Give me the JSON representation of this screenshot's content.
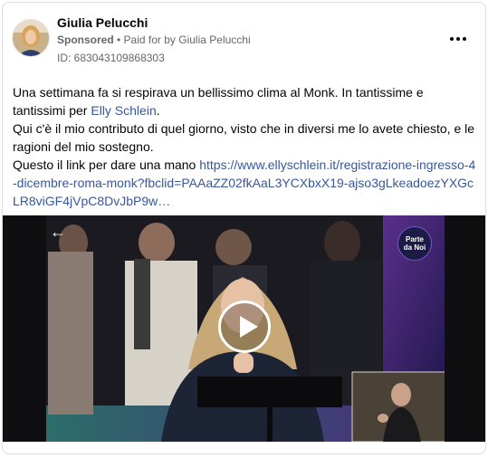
{
  "post": {
    "author": "Giulia Pelucchi",
    "sponsored": "Sponsored",
    "paid_prefix": " • Paid for by ",
    "paid_by": "Giulia Pelucchi",
    "id_line": "ID: 683043109868303",
    "text_1a": "Una settimana fa si respirava un bellissimo clima al Monk. In tantissime e tantissimi per ",
    "mention": "Elly Schlein",
    "text_1b": ".",
    "text_2": "Qui c'è il mio contributo di quel giorno, visto che in diversi me lo avete chiesto, e le ragioni del mio sostegno.",
    "text_3": "Questo il link per dare una mano ",
    "link": "https://www.ellyschlein.it/registrazione-ingresso-4-dicembre-roma-monk?fbclid=PAAaZZ02fkAaL3YCXbxX19-ajso3gLkeadoezYXGcLR8viGF4jVpC8DvJbP9w…"
  },
  "video": {
    "badge_line1": "Parte",
    "badge_line2": "da Noi"
  },
  "icons": {
    "more": "more-horizontal-icon",
    "play": "play-icon",
    "back": "arrow-left-icon"
  },
  "colors": {
    "link": "#385898",
    "secondary_text": "#65676b",
    "stage_purple": "#4a2a7a"
  }
}
